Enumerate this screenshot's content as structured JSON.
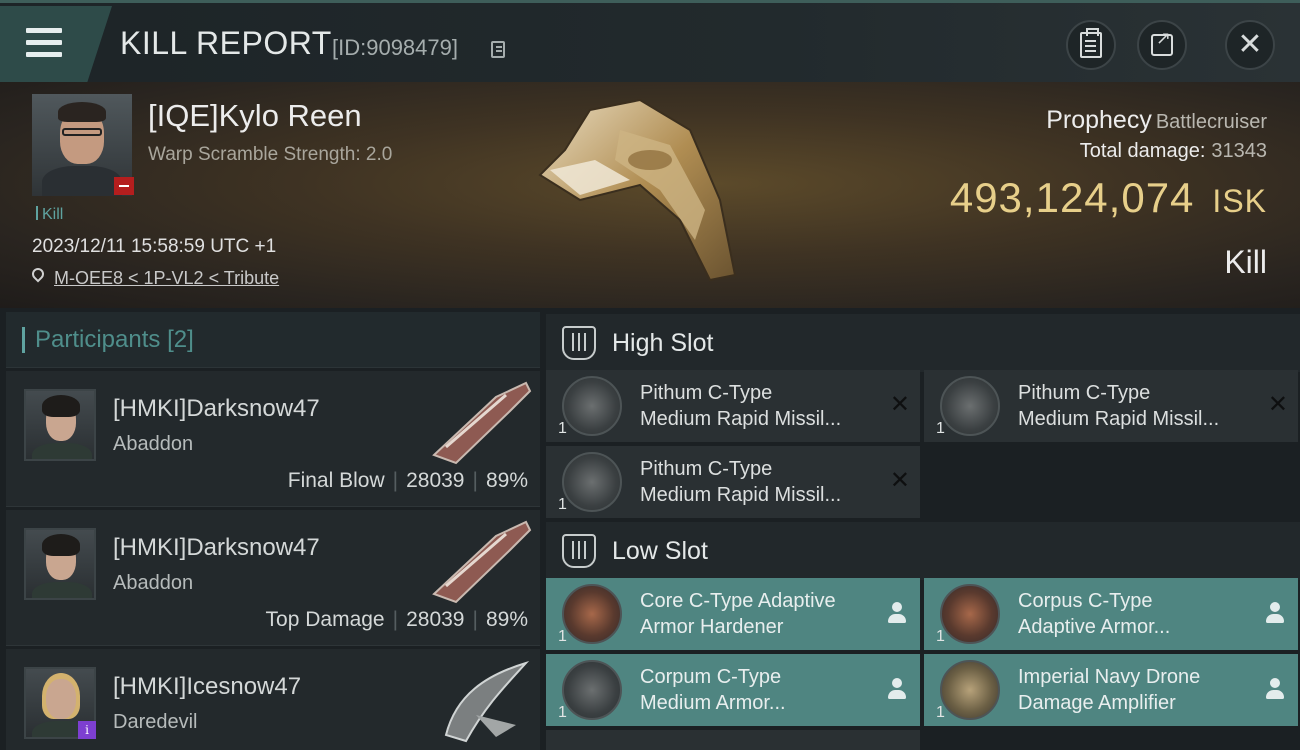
{
  "header": {
    "title": "KILL REPORT",
    "report_id": "[ID:9098479]"
  },
  "victim": {
    "name": "[IQE]Kylo Reen",
    "warp_scramble": "Warp Scramble Strength: 2.0",
    "tag": "Kill",
    "datetime": "2023/12/11 15:58:59 UTC +1",
    "location": "M-OEE8 < 1P-VL2 < Tribute",
    "ship_name": "Prophecy",
    "ship_class": "Battlecruiser",
    "total_damage_label": "Total damage:",
    "total_damage": "31343",
    "isk_value": "493,124,074",
    "isk_unit": "ISK",
    "result": "Kill"
  },
  "participants": {
    "header": "Participants",
    "count": "[2]",
    "items": [
      {
        "name": "[HMKI]Darksnow47",
        "ship": "Abaddon",
        "role": "Final Blow",
        "damage": "28039",
        "percent": "89%"
      },
      {
        "name": "[HMKI]Darksnow47",
        "ship": "Abaddon",
        "role": "Top Damage",
        "damage": "28039",
        "percent": "89%"
      },
      {
        "name": "[HMKI]Icesnow47",
        "ship": "Daredevil"
      }
    ],
    "separator": "|",
    "info_badge": "i"
  },
  "slots": {
    "high": {
      "label": "High Slot",
      "items": [
        {
          "name": "Pithum C-Type\nMedium Rapid Missil...",
          "qty": "1"
        },
        {
          "name": "Pithum C-Type\nMedium Rapid Missil...",
          "qty": "1"
        },
        {
          "name": "Pithum C-Type\nMedium Rapid Missil...",
          "qty": "1"
        }
      ]
    },
    "low": {
      "label": "Low Slot",
      "items": [
        {
          "name": "Core C-Type Adaptive\n Armor Hardener",
          "qty": "1"
        },
        {
          "name": "Corpus C-Type\nAdaptive Armor...",
          "qty": "1"
        },
        {
          "name": "Corpum C-Type\nMedium Armor...",
          "qty": "1"
        },
        {
          "name": "Imperial Navy Drone\nDamage Amplifier",
          "qty": "1"
        }
      ]
    }
  },
  "icons": {
    "menu": "hamburger-menu-icon",
    "copy": "copy-icon",
    "clipboard": "clipboard-icon",
    "share": "share-icon",
    "close": "close-icon",
    "location": "location-pin-icon",
    "slot": "slot-rack-icon",
    "dropped": "x-icon",
    "fitted": "person-icon"
  },
  "colors": {
    "accent_teal": "#5fa3a0",
    "low_slot_bg": "#4f8581",
    "isk_gold": "#e7cf8a",
    "status_red": "#b41e1e",
    "info_purple": "#7d3fd1"
  }
}
